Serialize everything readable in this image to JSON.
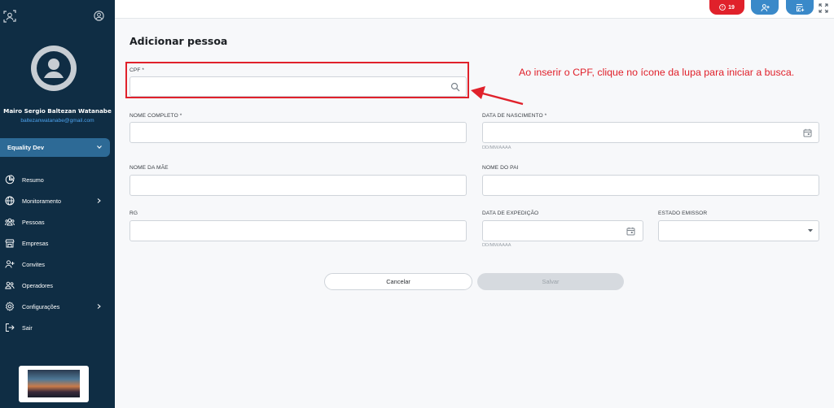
{
  "sidebar": {
    "user_name": "Mairo Sergio Baltezan Watanabe",
    "user_email": "baltezanwatanabe@gmail.com",
    "org": "Equality Dev",
    "items": [
      {
        "label": "Resumo",
        "icon": "chart-pie-icon",
        "arrow": false
      },
      {
        "label": "Monitoramento",
        "icon": "globe-icon",
        "arrow": true
      },
      {
        "label": "Pessoas",
        "icon": "people-icon",
        "arrow": false
      },
      {
        "label": "Empresas",
        "icon": "store-icon",
        "arrow": false
      },
      {
        "label": "Convites",
        "icon": "person-add-icon",
        "arrow": false
      },
      {
        "label": "Operadores",
        "icon": "group-icon",
        "arrow": false
      },
      {
        "label": "Configurações",
        "icon": "gear-icon",
        "arrow": true
      },
      {
        "label": "Sair",
        "icon": "logout-icon",
        "arrow": false
      }
    ]
  },
  "topbar": {
    "alert_count": "19"
  },
  "form": {
    "title": "Adicionar pessoa",
    "cpf_label": "CPF *",
    "nome_label": "NOME COMPLETO *",
    "nascimento_label": "DATA DE NASCIMENTO *",
    "date_hint": "DD/MM/AAAA",
    "mae_label": "NOME DA MÃE",
    "pai_label": "NOME DO PAI",
    "rg_label": "RG",
    "expedicao_label": "DATA DE EXPEDIÇÃO",
    "estado_label": "ESTADO EMISSOR",
    "cancel_label": "Cancelar",
    "save_label": "Salvar"
  },
  "annotation": {
    "text": "Ao inserir o CPF, clique no ícone da lupa para iniciar a busca."
  },
  "colors": {
    "sidebar": "#0f2d44",
    "accent": "#3a89c9",
    "alert": "#e0212b"
  }
}
